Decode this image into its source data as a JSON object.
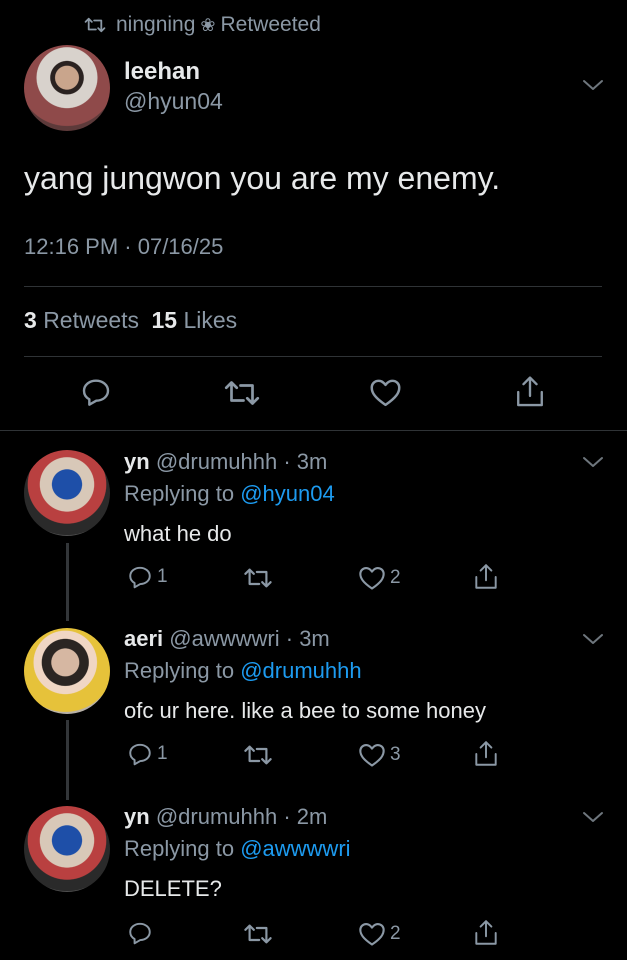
{
  "retweet_header": {
    "user": "ningning",
    "flower": "❀",
    "suffix": "Retweeted"
  },
  "main_tweet": {
    "display_name": "leehan",
    "handle": "@hyun04",
    "text": "yang jungwon you are my enemy.",
    "time": "12:16 PM · 07/16/25",
    "retweets_count": "3",
    "retweets_label": "Retweets",
    "likes_count": "15",
    "likes_label": "Likes"
  },
  "replies": [
    {
      "display_name": "yn",
      "handle": "@drumuhhh",
      "time": "· 3m",
      "replying_prefix": "Replying to",
      "replying_to": "@hyun04",
      "text": "what he do",
      "reply_count": "1",
      "retweet_count": "",
      "like_count": "2"
    },
    {
      "display_name": "aeri",
      "handle": "@awwwwri",
      "time": "· 3m",
      "replying_prefix": "Replying to",
      "replying_to": "@drumuhhh",
      "text": "ofc ur here. like a bee to some honey",
      "reply_count": "1",
      "retweet_count": "",
      "like_count": "3"
    },
    {
      "display_name": "yn",
      "handle": "@drumuhhh",
      "time": "· 2m",
      "replying_prefix": "Replying to",
      "replying_to": "@awwwwri",
      "text": "DELETE?",
      "reply_count": "",
      "retweet_count": "",
      "like_count": "2"
    }
  ],
  "colors": {
    "background": "#000000",
    "text": "#e7e9ea",
    "muted": "#8b98a5",
    "link": "#1d9bf0",
    "divider": "#2f3336"
  }
}
